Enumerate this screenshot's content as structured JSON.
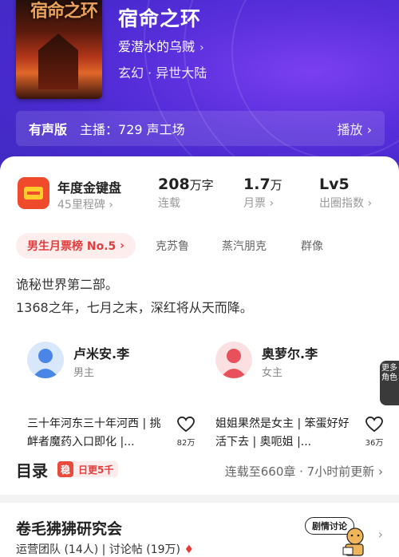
{
  "book": {
    "cover_title": "宿命之环",
    "title": "宿命之环",
    "author": "爱潜水的乌贼",
    "genre": "玄幻 · 异世大陆"
  },
  "audio": {
    "tag": "有声版",
    "anchor": "主播：729 声工场",
    "play_label": "播放"
  },
  "award": {
    "title": "年度金键盘",
    "subtitle": "45里程碑"
  },
  "stats": [
    {
      "num": "208",
      "unit": "万字",
      "label": "连载"
    },
    {
      "num": "1.7",
      "unit": "万",
      "label": "月票"
    },
    {
      "num": "Lv5",
      "unit": "",
      "label": "出圈指数"
    }
  ],
  "tags": {
    "rank": "男生月票榜 No.5",
    "items": [
      "克苏鲁",
      "蒸汽朋克",
      "群像"
    ]
  },
  "description": [
    "诡秘世界第二部。",
    "1368之年，七月之末，深红将从天而降。"
  ],
  "roles": [
    {
      "name": "卢米安.李",
      "type": "男主",
      "quote": "三十年河东三十年河西 | 挑衅者魔药入口即化 |...",
      "likes": "82万",
      "color": "#4a86e8"
    },
    {
      "name": "奥萝尔.李",
      "type": "女主",
      "quote": "姐姐果然是女主 | 笨蛋好好活下去 | 奥呃姐 |...",
      "likes": "36万",
      "color": "#e8505b"
    }
  ],
  "more_roles": "更多角色",
  "toc": {
    "heading": "目录",
    "badge": "稳",
    "update_tag": "日更5千",
    "status": "连载至660章 · 7小时前更新"
  },
  "club": {
    "title": "卷毛狒狒研究会",
    "meta": "运营团队 (14人) | 讨论帖 (19万)",
    "bubble": "剧情讨论"
  }
}
